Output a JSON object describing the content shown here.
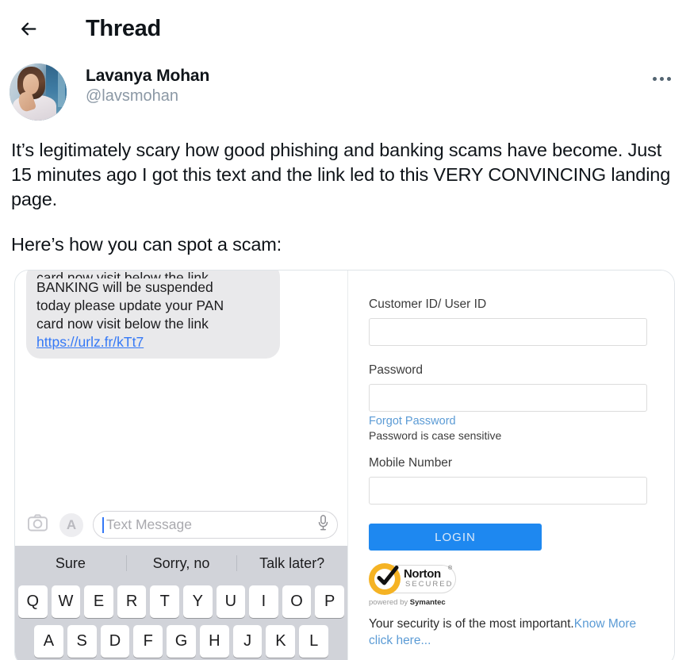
{
  "header": {
    "back_icon": "arrow-left-icon",
    "title": "Thread",
    "more_icon": "more-horizontal-icon"
  },
  "tweet": {
    "display_name": "Lavanya Mohan",
    "handle": "@lavsmohan",
    "avatar_alt": "Lavanya Mohan profile photo",
    "paragraphs": [
      "It’s legitimately scary how good phishing and banking scams have become. Just 15 minutes ago I got this text and the link led to this VERY CONVINCING landing page.",
      "Here’s how you can spot a scam:"
    ]
  },
  "media": {
    "sms": {
      "truncated_previous_line": "card now visit below the link",
      "bubble_lines": [
        "BANKING will be suspended",
        "today please update your PAN",
        "card now visit below the link"
      ],
      "bubble_link": "https://urlz.fr/kTt7",
      "camera_icon": "camera-icon",
      "appstore_icon": "app-store-icon",
      "input_placeholder": "Text Message",
      "mic_icon": "microphone-icon",
      "suggestions": [
        "Sure",
        "Sorry, no",
        "Talk later?"
      ],
      "keyboard_row1": [
        "Q",
        "W",
        "E",
        "R",
        "T",
        "Y",
        "U",
        "I",
        "O",
        "P"
      ],
      "keyboard_row2": [
        "A",
        "S",
        "D",
        "F",
        "G",
        "H",
        "J",
        "K",
        "L"
      ]
    },
    "login": {
      "customer_id_label": "Customer ID/ User ID",
      "customer_id_value": "",
      "password_label": "Password",
      "password_value": "",
      "forgot_password": "Forgot Password",
      "case_note": "Password is case sensitive",
      "mobile_label": "Mobile Number",
      "mobile_value": "",
      "login_button": "LOGIN",
      "norton": {
        "word": "Norton",
        "trademark": "®",
        "subtitle": "SECURED",
        "powered_prefix": "powered by ",
        "powered_brand": "Symantec"
      },
      "security_text": "Your security is of the most important.",
      "security_link": "Know More click here..."
    }
  },
  "colors": {
    "link_blue": "#5b9bd5",
    "login_blue": "#1e88f0",
    "sms_link_blue": "#3478f6",
    "norton_yellow": "#f5b324",
    "bubble_gray": "#e9e9eb",
    "keyboard_gray": "#d1d3d9",
    "handle_gray": "#8b98a5",
    "text_dark": "#0f1419"
  }
}
